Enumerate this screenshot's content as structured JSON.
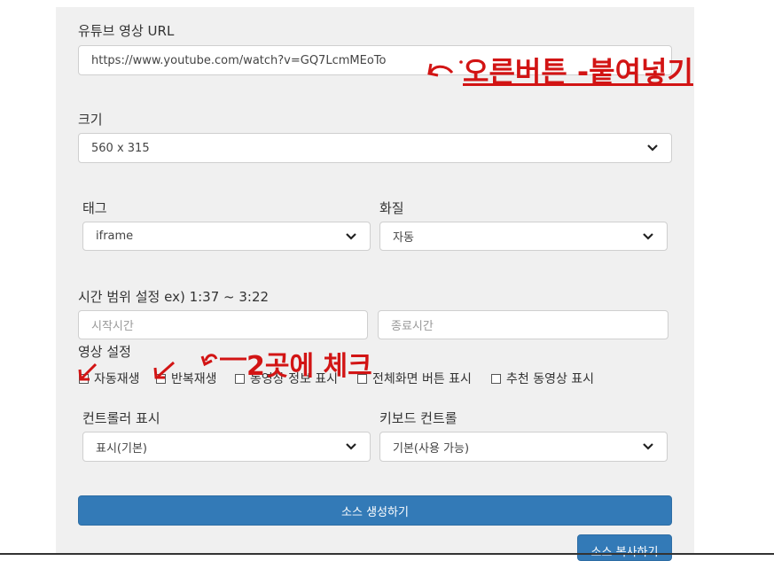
{
  "url_section": {
    "label": "유튜브 영상 URL",
    "value": "https://www.youtube.com/watch?v=GQ7LcmMEoTo"
  },
  "size_section": {
    "label": "크기",
    "selected": "560 x 315"
  },
  "tag_section": {
    "label": "태그",
    "selected": "iframe"
  },
  "quality_section": {
    "label": "화질",
    "selected": "자동"
  },
  "time_section": {
    "label": "시간 범위 설정 ex) 1:37  ~  3:22",
    "start_placeholder": "시작시간",
    "end_placeholder": "종료시간"
  },
  "video_settings": {
    "label": "영상 설정",
    "options": [
      {
        "label": "자동재생",
        "checked": false
      },
      {
        "label": "반복재생",
        "checked": false
      },
      {
        "label": "동영상 정보 표시",
        "checked": false
      },
      {
        "label": "전체화면 버튼 표시",
        "checked": false
      },
      {
        "label": "추천 동영상 표시",
        "checked": false
      }
    ]
  },
  "controller_section": {
    "label": "컨트롤러 표시",
    "selected": "표시(기본)"
  },
  "keyboard_section": {
    "label": "키보드 컨트롤",
    "selected": "기본(사용 가능)"
  },
  "buttons": {
    "generate": "소스 생성하기",
    "copy": "소스 복사하기"
  },
  "annotations": {
    "paste_note": "오른버튼 -붙여넣기",
    "check_note": "2곳에 체크",
    "color": "#d21414"
  }
}
